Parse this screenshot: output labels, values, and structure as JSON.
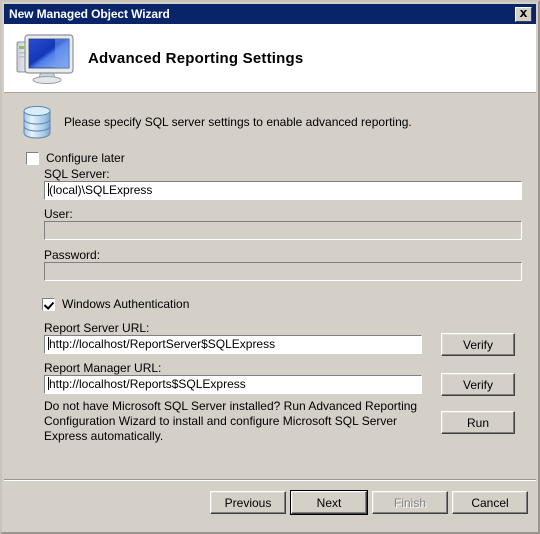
{
  "window": {
    "title": "New Managed Object Wizard",
    "close_icon": "close-icon"
  },
  "header": {
    "title": "Advanced Reporting Settings",
    "icon": "computer-monitor-icon"
  },
  "instruction": {
    "icon": "database-icon",
    "text": "Please specify SQL server settings to enable advanced reporting."
  },
  "form": {
    "configure_later": {
      "label": "Configure later",
      "checked": false
    },
    "sql_server": {
      "label": "SQL Server:",
      "value": "(local)\\SQLExpress",
      "enabled": true
    },
    "user": {
      "label": "User:",
      "value": "",
      "enabled": false
    },
    "password": {
      "label": "Password:",
      "value": "",
      "enabled": false
    },
    "windows_authentication": {
      "label": "Windows Authentication",
      "checked": true
    },
    "report_server_url": {
      "label": "Report Server URL:",
      "value": "http://localhost/ReportServer$SQLExpress",
      "verify_label": "Verify"
    },
    "report_manager_url": {
      "label": "Report Manager URL:",
      "value": "http://localhost/Reports$SQLExpress",
      "verify_label": "Verify"
    },
    "run_label": "Run",
    "note": "Do not have Microsoft SQL Server installed? Run Advanced Reporting Configuration Wizard to install and configure Microsoft SQL Server Express automatically."
  },
  "footer": {
    "previous_label": "Previous",
    "next_label": "Next",
    "finish_label": "Finish",
    "cancel_label": "Cancel"
  },
  "colors": {
    "titlebar": "#0a246a",
    "dialog_face": "#d4d0c8",
    "header_background": "#ffffff",
    "disabled_text": "#808080"
  }
}
